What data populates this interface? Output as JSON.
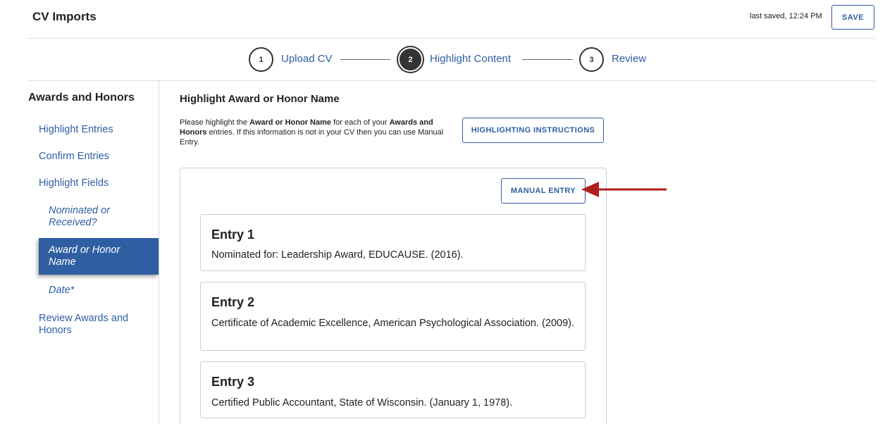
{
  "header": {
    "title": "CV Imports",
    "last_saved": "last saved, 12:24 PM",
    "save_label": "SAVE"
  },
  "stepper": {
    "steps": [
      {
        "number": "1",
        "label": "Upload CV",
        "active": false
      },
      {
        "number": "2",
        "label": "Highlight Content",
        "active": true
      },
      {
        "number": "3",
        "label": "Review",
        "active": false
      }
    ]
  },
  "sidebar": {
    "heading": "Awards and Honors",
    "items": [
      {
        "label": "Highlight Entries"
      },
      {
        "label": "Confirm Entries"
      },
      {
        "label": "Highlight Fields"
      },
      {
        "label": "Nominated or Received?"
      },
      {
        "label": "Award or Honor Name",
        "active": true
      },
      {
        "label": "Date*"
      },
      {
        "label": "Review Awards and Honors"
      }
    ]
  },
  "main": {
    "heading": "Highlight Award or Honor Name",
    "instruction": {
      "part1": "Please highlight the ",
      "bold1": "Award or Honor Name",
      "part2": " for each of your ",
      "bold2": "Awards and Honors",
      "part3": " entries. If this information is not in your CV then you can use Manual Entry."
    },
    "highlighting_instructions_label": "HIGHLIGHTING INSTRUCTIONS",
    "manual_entry_label": "MANUAL ENTRY",
    "arrow_color": "#b01f1f",
    "accent_color": "#2f5ea3",
    "entries": [
      {
        "title": "Entry 1",
        "text": "Nominated for: Leadership Award, EDUCAUSE. (2016)."
      },
      {
        "title": "Entry 2",
        "text": "Certificate of Academic Excellence, American Psychological Association. (2009)."
      },
      {
        "title": "Entry 3",
        "text": "Certified Public Accountant, State of Wisconsin. (January 1, 1978)."
      }
    ]
  }
}
